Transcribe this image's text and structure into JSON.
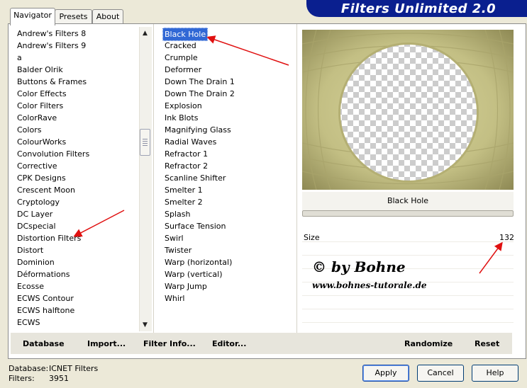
{
  "banner": {
    "title": "Filters Unlimited 2.0"
  },
  "tabs": [
    {
      "label": "Navigator",
      "active": true
    },
    {
      "label": "Presets",
      "active": false
    },
    {
      "label": "About",
      "active": false
    }
  ],
  "categories": [
    "Andrew's Filters 8",
    "Andrew's Filters 9",
    "a",
    "Balder Olrik",
    "Buttons & Frames",
    "Color Effects",
    "Color Filters",
    "ColorRave",
    "Colors",
    "ColourWorks",
    "Convolution Filters",
    "Corrective",
    "CPK Designs",
    "Crescent Moon",
    "Cryptology",
    "DC Layer",
    "DCspecial",
    "Distortion Filters",
    "Distort",
    "Dominion",
    "Déformations",
    "Ecosse",
    "ECWS Contour",
    "ECWS halftone",
    "ECWS"
  ],
  "filters": [
    "Black Hole",
    "Cracked",
    "Crumple",
    "Deformer",
    "Down The Drain 1",
    "Down The Drain 2",
    "Explosion",
    "Ink Blots",
    "Magnifying Glass",
    "Radial Waves",
    "Refractor 1",
    "Refractor 2",
    "Scanline Shifter",
    "Smelter 1",
    "Smelter 2",
    "Splash",
    "Surface Tension",
    "Swirl",
    "Twister",
    "Warp (horizontal)",
    "Warp (vertical)",
    "Warp Jump",
    "Whirl"
  ],
  "selected_filter": "Black Hole",
  "preview": {
    "label": "Black Hole"
  },
  "params": {
    "size_label": "Size",
    "size_value": "132"
  },
  "watermark": {
    "line1": "© by Bohne",
    "line2": "www.bohnes-tutorale.de"
  },
  "toolbar": {
    "database": "Database",
    "import": "Import...",
    "filter_info": "Filter Info...",
    "editor": "Editor...",
    "randomize": "Randomize",
    "reset": "Reset"
  },
  "status": {
    "database_label": "Database:",
    "database_value": "ICNET Filters",
    "filters_label": "Filters:",
    "filters_value": "3951"
  },
  "buttons": {
    "apply": "Apply",
    "cancel": "Cancel",
    "help": "Help"
  },
  "colors": {
    "banner": "#0a1f8f",
    "selection": "#3168d5",
    "arrow": "#e01010",
    "preview_tone": "#b6b27c"
  }
}
